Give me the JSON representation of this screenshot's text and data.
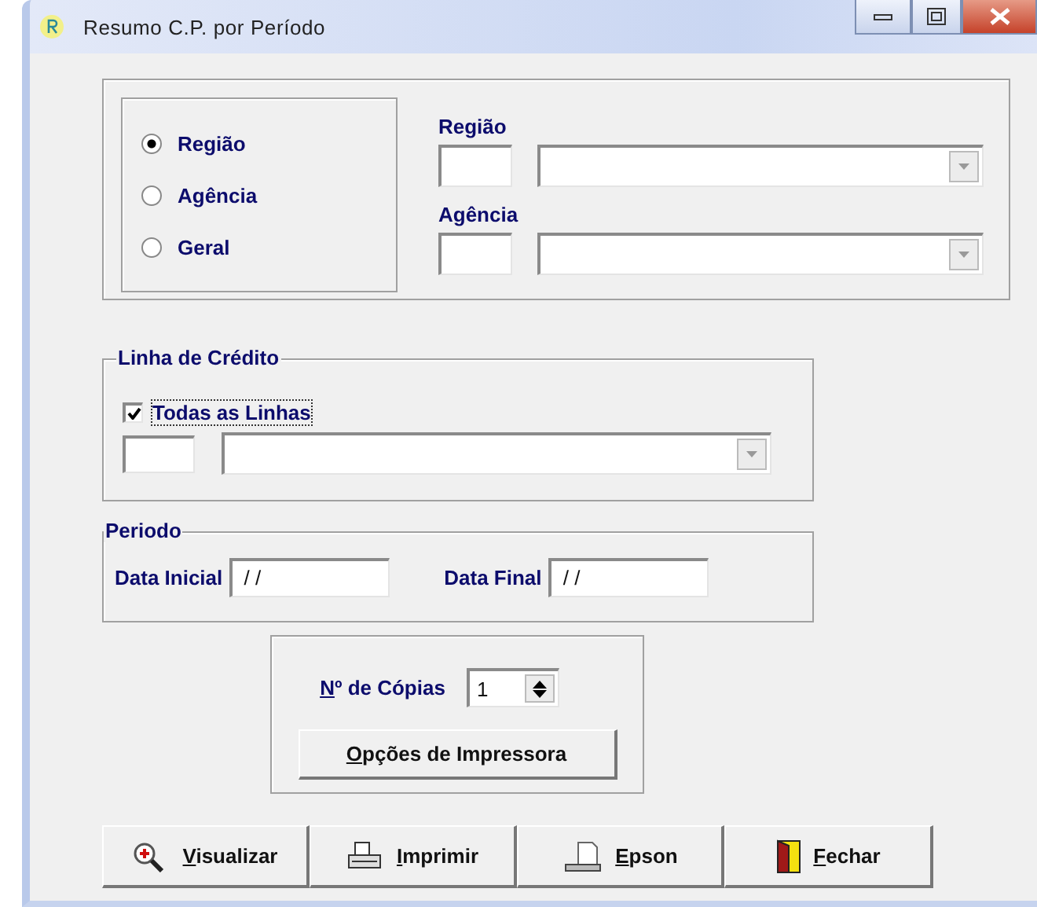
{
  "window": {
    "title": "Resumo C.P. por Período"
  },
  "scope": {
    "options": [
      {
        "label": "Região",
        "selected": true
      },
      {
        "label": "Agência",
        "selected": false
      },
      {
        "label": "Geral",
        "selected": false
      }
    ]
  },
  "lookups": [
    {
      "label": "Região"
    },
    {
      "label": "Agência"
    }
  ],
  "credit_line": {
    "title": "Linha de Crédito",
    "all_lines": {
      "label": "Todas as Linhas",
      "checked": true
    }
  },
  "period": {
    "title": "Periodo",
    "fields": [
      {
        "label": "Data Inicial",
        "value": " / /"
      },
      {
        "label": "Data Final",
        "value": " / /"
      }
    ]
  },
  "copies": {
    "label": "Nº de Cópias",
    "value": "1",
    "options_button": "Opções de Impressora"
  },
  "buttons": [
    {
      "kind": "preview",
      "label": "Visualizar"
    },
    {
      "kind": "print",
      "label": "Imprimir"
    },
    {
      "kind": "epson",
      "label": "Epson"
    },
    {
      "kind": "close",
      "label": "Fechar"
    }
  ]
}
